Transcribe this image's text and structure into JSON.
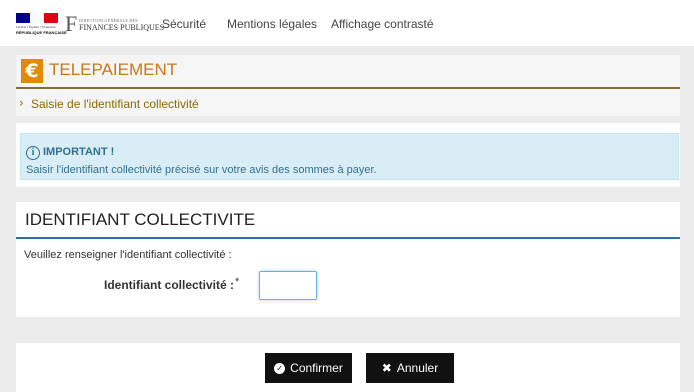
{
  "header": {
    "logo_rf": {
      "motto": "Liberté • Égalité • Fraternité",
      "name": "RÉPUBLIQUE FRANÇAISE"
    },
    "logo_dgfip": {
      "line1": "DIRECTION GÉNÉRALE DES",
      "line2": "FINANCES PUBLIQUES"
    },
    "nav": [
      "Sécurité",
      "Mentions légales",
      "Affichage contrasté"
    ]
  },
  "page": {
    "title": "TELEPAIEMENT",
    "title_icon": "euro-icon",
    "breadcrumb": "Saisie de l'identifiant collectivité"
  },
  "alert": {
    "icon": "info-icon",
    "title": "IMPORTANT !",
    "text": "Saisir l'identifiant collectivité précisé sur votre avis des sommes à payer."
  },
  "form": {
    "title": "IDENTIFIANT COLLECTIVITE",
    "intro": "Veuillez renseigner l'identifiant collectivité :",
    "field_label": "Identifiant collectivité :",
    "required_mark": "*",
    "field_value": ""
  },
  "actions": {
    "confirm": "Confirmer",
    "cancel": "Annuler"
  },
  "colors": {
    "accent": "#e28a00",
    "title": "#c8771a",
    "breadcrumb": "#8b6a00",
    "info_bg": "#d9edf7",
    "info_text": "#31708f",
    "form_rule": "#2f6fa8",
    "button_bg": "#111111"
  }
}
